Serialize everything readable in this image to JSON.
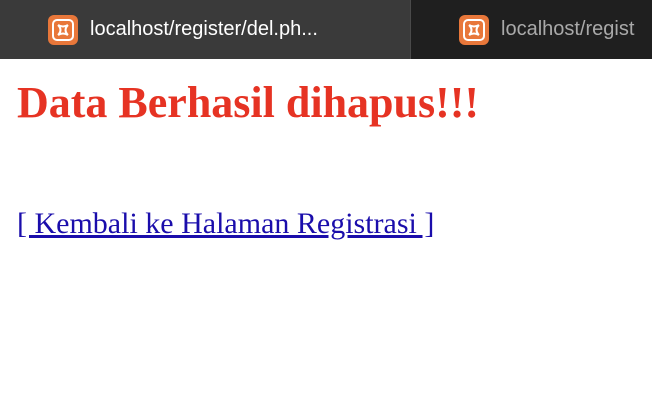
{
  "tabs": [
    {
      "title": "localhost/register/del.ph...",
      "favicon": "xampp-icon",
      "active": true
    },
    {
      "title": "localhost/regist",
      "favicon": "xampp-icon",
      "active": false
    }
  ],
  "page": {
    "heading": "Data Berhasil dihapus!!!",
    "back_link": "[ Kembali ke Halaman Registrasi ]"
  },
  "colors": {
    "heading": "#e63323",
    "link": "#1a0dab",
    "favicon": "#e8773a",
    "tab_active_bg": "#3a3a3a",
    "tab_inactive_bg": "#1f1f1f"
  }
}
